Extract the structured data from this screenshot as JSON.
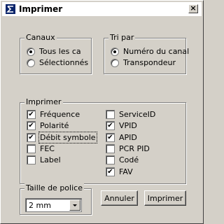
{
  "window": {
    "title": "Imprimer",
    "close_glyph": "×"
  },
  "canaux": {
    "legend": "Canaux",
    "options": [
      {
        "label": "Tous les ca",
        "selected": true
      },
      {
        "label": "Sélectionnés",
        "selected": false
      }
    ]
  },
  "tri": {
    "legend": "Tri par",
    "options": [
      {
        "label": "Numéro du canal",
        "selected": true
      },
      {
        "label": "Transpondeur",
        "selected": false
      }
    ]
  },
  "imprimer": {
    "legend": "Imprimer",
    "left": [
      {
        "label": "Fréquence",
        "checked": true
      },
      {
        "label": "Polarité",
        "checked": true
      },
      {
        "label": "Débit symbole",
        "checked": true,
        "focused": true
      },
      {
        "label": "FEC",
        "checked": false
      },
      {
        "label": "Label",
        "checked": false
      }
    ],
    "right": [
      {
        "label": "ServiceID",
        "checked": false
      },
      {
        "label": "VPID",
        "checked": true
      },
      {
        "label": "APID",
        "checked": true
      },
      {
        "label": "PCR PID",
        "checked": false
      },
      {
        "label": "Codé",
        "checked": false
      },
      {
        "label": "FAV",
        "checked": true
      }
    ]
  },
  "taille": {
    "legend": "Taille de police",
    "value": "2 mm"
  },
  "buttons": {
    "annuler": "Annuler",
    "imprimer": "Imprimer"
  },
  "check_glyph": "✔",
  "icons": {
    "app": "app-icon",
    "close": "close-icon"
  }
}
